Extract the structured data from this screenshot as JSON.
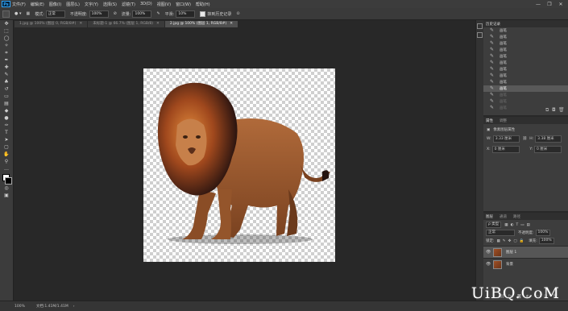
{
  "menu": {
    "items": [
      "文件(F)",
      "编辑(E)",
      "图像(I)",
      "图层(L)",
      "文字(Y)",
      "选择(S)",
      "滤镜(T)",
      "3D(D)",
      "视图(V)",
      "窗口(W)",
      "帮助(H)"
    ],
    "window_controls": [
      "—",
      "❐",
      "✕"
    ]
  },
  "options": {
    "mode_label": "模式:",
    "mode_value": "正常",
    "opacity_label": "不透明度:",
    "opacity_value": "100%",
    "flow_label": "流量:",
    "flow_value": "100%",
    "smoothing_label": "平滑:",
    "smoothing_value": "10%",
    "erase_history_label": "抹到历史记录"
  },
  "tabs": [
    {
      "label": "1.jpg @ 100% (图层 0, RGB/8#)",
      "active": false
    },
    {
      "label": "未标题-1 @ 66.7% (图层 1, RGB/8)",
      "active": false
    },
    {
      "label": "2.jpg @ 100% (图层 1, RGB/8#)",
      "active": true
    }
  ],
  "history": {
    "tabs": [
      "历史记录"
    ],
    "items": [
      {
        "label": "画笔",
        "state": "normal"
      },
      {
        "label": "画笔",
        "state": "normal"
      },
      {
        "label": "画笔",
        "state": "normal"
      },
      {
        "label": "画笔",
        "state": "normal"
      },
      {
        "label": "画笔",
        "state": "normal"
      },
      {
        "label": "画笔",
        "state": "normal"
      },
      {
        "label": "画笔",
        "state": "normal"
      },
      {
        "label": "画笔",
        "state": "normal"
      },
      {
        "label": "画笔",
        "state": "normal"
      },
      {
        "label": "画笔",
        "state": "selected"
      },
      {
        "label": "画笔",
        "state": "inactive"
      },
      {
        "label": "画笔",
        "state": "inactive"
      },
      {
        "label": "画笔",
        "state": "inactive"
      }
    ]
  },
  "properties": {
    "tabs": [
      "属性",
      "调整"
    ],
    "layer_type": "像素图层属性",
    "w_label": "W:",
    "w_value": "3.33 厘米",
    "h_label": "H:",
    "h_value": "3.38 厘米",
    "x_label": "X:",
    "x_value": "0 厘米",
    "y_label": "Y:",
    "y_value": "0 厘米"
  },
  "layers": {
    "tabs": [
      "图层",
      "通道",
      "路径"
    ],
    "kind": "ρ 类型",
    "blend_mode": "正常",
    "opacity_label": "不透明度:",
    "opacity_value": "100%",
    "lock_label": "锁定:",
    "fill_label": "填充:",
    "fill_value": "100%",
    "items": [
      {
        "name": "图层 1",
        "selected": true
      },
      {
        "name": "背景",
        "selected": false
      }
    ]
  },
  "status": {
    "zoom": "100%",
    "doc_info": "文档:1.41M/1.41M"
  },
  "watermark": "UiBQ.CoM"
}
